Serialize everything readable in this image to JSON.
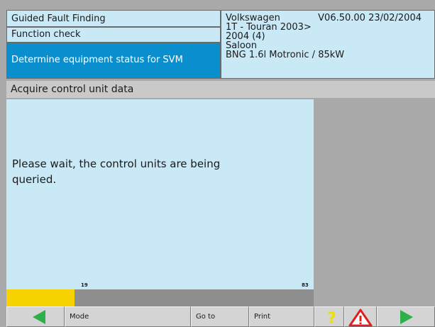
{
  "breadcrumb": {
    "level1": "Guided Fault Finding",
    "level2": "Function check",
    "level3": "Determine equipment status for SVM"
  },
  "vehicle": {
    "make": "Volkswagen",
    "version": "V06.50.00 23/02/2004",
    "model": "1T - Touran 2003>",
    "year": "2004 (4)",
    "body": "Saloon",
    "engine": "BNG 1.6l Motronic / 85kW"
  },
  "section_title": "Acquire control unit data",
  "message": "Please wait, the control units are being queried.",
  "progress": {
    "current": "19",
    "max": "83",
    "value": 19,
    "maximum": 83
  },
  "toolbar": {
    "mode_label": "Mode",
    "goto_label": "Go to",
    "print_label": "Print",
    "back_icon": "left-arrow-icon",
    "forward_icon": "right-arrow-icon",
    "help_icon": "question-mark-icon",
    "warning_icon": "warning-triangle-icon"
  },
  "colors": {
    "panel_bg": "#c9e9f7",
    "selected_bg": "#0a8fce",
    "progress": "#f5d200",
    "arrow": "#2db04a",
    "warning": "#e02020"
  }
}
